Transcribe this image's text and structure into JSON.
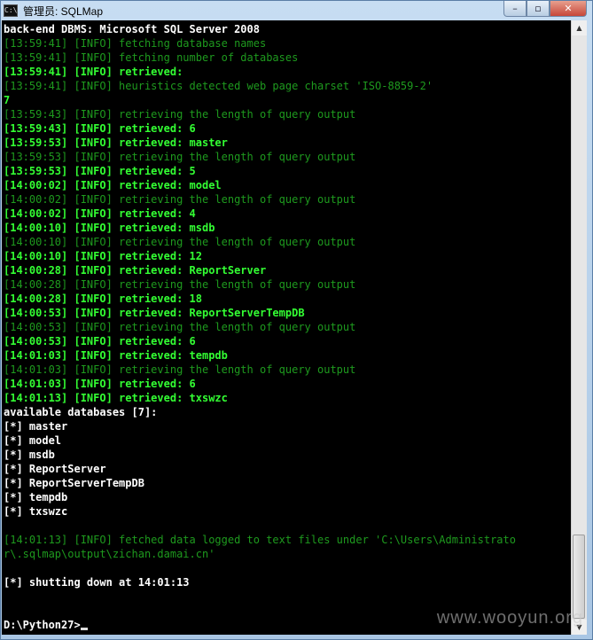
{
  "window": {
    "title": "管理员: SQLMap",
    "icon_label": "C:\\",
    "minimize": "–",
    "maximize": "▫",
    "close": "✕"
  },
  "console": {
    "lines": [
      {
        "text": "back-end DBMS: Microsoft SQL Server 2008",
        "style": "white"
      },
      {
        "text": "[13:59:41] [INFO] fetching database names",
        "style": "dim"
      },
      {
        "text": "[13:59:41] [INFO] fetching number of databases",
        "style": "dim"
      },
      {
        "text": "[13:59:41] [INFO] retrieved:",
        "style": "bright"
      },
      {
        "text": "[13:59:41] [INFO] heuristics detected web page charset 'ISO-8859-2'",
        "style": "dim"
      },
      {
        "text": "7",
        "style": "bright"
      },
      {
        "text": "[13:59:43] [INFO] retrieving the length of query output",
        "style": "dim"
      },
      {
        "text": "[13:59:43] [INFO] retrieved: 6",
        "style": "bright"
      },
      {
        "text": "[13:59:53] [INFO] retrieved: master",
        "style": "bright"
      },
      {
        "text": "[13:59:53] [INFO] retrieving the length of query output",
        "style": "dim"
      },
      {
        "text": "[13:59:53] [INFO] retrieved: 5",
        "style": "bright"
      },
      {
        "text": "[14:00:02] [INFO] retrieved: model",
        "style": "bright"
      },
      {
        "text": "[14:00:02] [INFO] retrieving the length of query output",
        "style": "dim"
      },
      {
        "text": "[14:00:02] [INFO] retrieved: 4",
        "style": "bright"
      },
      {
        "text": "[14:00:10] [INFO] retrieved: msdb",
        "style": "bright"
      },
      {
        "text": "[14:00:10] [INFO] retrieving the length of query output",
        "style": "dim"
      },
      {
        "text": "[14:00:10] [INFO] retrieved: 12",
        "style": "bright"
      },
      {
        "text": "[14:00:28] [INFO] retrieved: ReportServer",
        "style": "bright"
      },
      {
        "text": "[14:00:28] [INFO] retrieving the length of query output",
        "style": "dim"
      },
      {
        "text": "[14:00:28] [INFO] retrieved: 18",
        "style": "bright"
      },
      {
        "text": "[14:00:53] [INFO] retrieved: ReportServerTempDB",
        "style": "bright"
      },
      {
        "text": "[14:00:53] [INFO] retrieving the length of query output",
        "style": "dim"
      },
      {
        "text": "[14:00:53] [INFO] retrieved: 6",
        "style": "bright"
      },
      {
        "text": "[14:01:03] [INFO] retrieved: tempdb",
        "style": "bright"
      },
      {
        "text": "[14:01:03] [INFO] retrieving the length of query output",
        "style": "dim"
      },
      {
        "text": "[14:01:03] [INFO] retrieved: 6",
        "style": "bright"
      },
      {
        "text": "[14:01:13] [INFO] retrieved: txswzc",
        "style": "bright"
      },
      {
        "text": "available databases [7]:",
        "style": "white"
      },
      {
        "text": "[*] master",
        "style": "white"
      },
      {
        "text": "[*] model",
        "style": "white"
      },
      {
        "text": "[*] msdb",
        "style": "white"
      },
      {
        "text": "[*] ReportServer",
        "style": "white"
      },
      {
        "text": "[*] ReportServerTempDB",
        "style": "white"
      },
      {
        "text": "[*] tempdb",
        "style": "white"
      },
      {
        "text": "[*] txswzc",
        "style": "white"
      },
      {
        "text": "",
        "style": "white"
      },
      {
        "text": "[14:01:13] [INFO] fetched data logged to text files under 'C:\\Users\\Administrato",
        "style": "dim"
      },
      {
        "text": "r\\.sqlmap\\output\\zichan.damai.cn'",
        "style": "dim"
      },
      {
        "text": "",
        "style": "white"
      },
      {
        "text": "[*] shutting down at 14:01:13",
        "style": "white"
      },
      {
        "text": "",
        "style": "white"
      },
      {
        "text": "",
        "style": "white"
      }
    ],
    "prompt": "D:\\Python27>"
  },
  "scrollbar": {
    "up": "▲",
    "down": "▼"
  },
  "watermark": "www.wooyun.org",
  "colors": {
    "dim": "#1e9a1e",
    "bright": "#33ff33",
    "white": "#ffffff",
    "background": "#000000"
  }
}
